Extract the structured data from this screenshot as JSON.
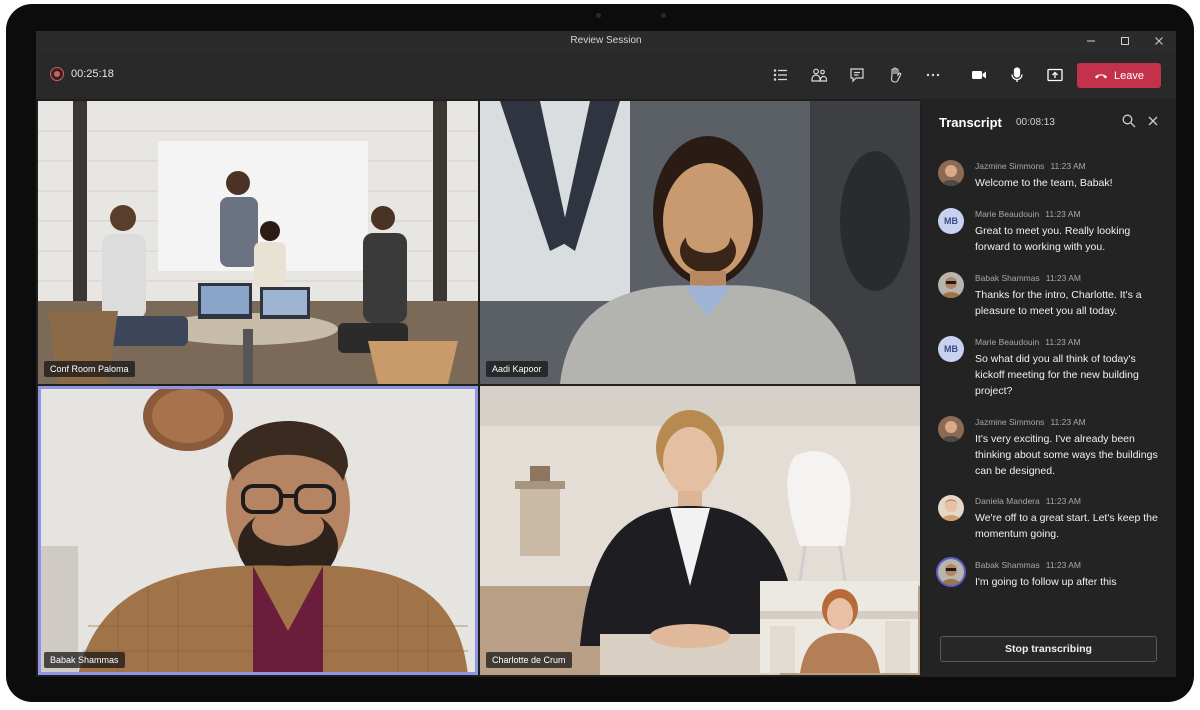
{
  "window": {
    "title": "Review Session"
  },
  "toolbar": {
    "elapsed": "00:25:18",
    "leave_label": "Leave",
    "icons": [
      "participants-list-icon",
      "people-icon",
      "chat-icon",
      "raise-hand-icon",
      "more-icon",
      "camera-icon",
      "microphone-icon",
      "share-screen-icon"
    ]
  },
  "tiles": [
    {
      "name": "Conf Room Paloma"
    },
    {
      "name": "Aadi Kapoor"
    },
    {
      "name": "Babak Shammas"
    },
    {
      "name": "Charlotte de Crum"
    }
  ],
  "transcript": {
    "title": "Transcript",
    "duration": "00:08:13",
    "stop_label": "Stop transcribing",
    "messages": [
      {
        "author": "Jazmine Simmons",
        "time": "11:23 AM",
        "text": "Welcome to the team, Babak!",
        "avatar": "photo"
      },
      {
        "author": "Marie Beaudouin",
        "time": "11:23 AM",
        "text": "Great to meet you. Really looking forward to working with you.",
        "avatar": "MB"
      },
      {
        "author": "Babak Shammas",
        "time": "11:23 AM",
        "text": "Thanks for the intro, Charlotte. It's a pleasure to meet you all today.",
        "avatar": "photo"
      },
      {
        "author": "Marie Beaudouin",
        "time": "11:23 AM",
        "text": "So what did you all think of today's kickoff meeting for the new building project?",
        "avatar": "MB"
      },
      {
        "author": "Jazmine Simmons",
        "time": "11:23 AM",
        "text": "It's very exciting. I've already been thinking about some ways the buildings can be designed.",
        "avatar": "photo"
      },
      {
        "author": "Daniela Mandera",
        "time": "11:23 AM",
        "text": "We're off to a great start. Let's keep the momentum going.",
        "avatar": "photo"
      },
      {
        "author": "Babak Shammas",
        "time": "11:23 AM",
        "text": "I'm going to follow up after this",
        "avatar": "photo"
      }
    ]
  }
}
